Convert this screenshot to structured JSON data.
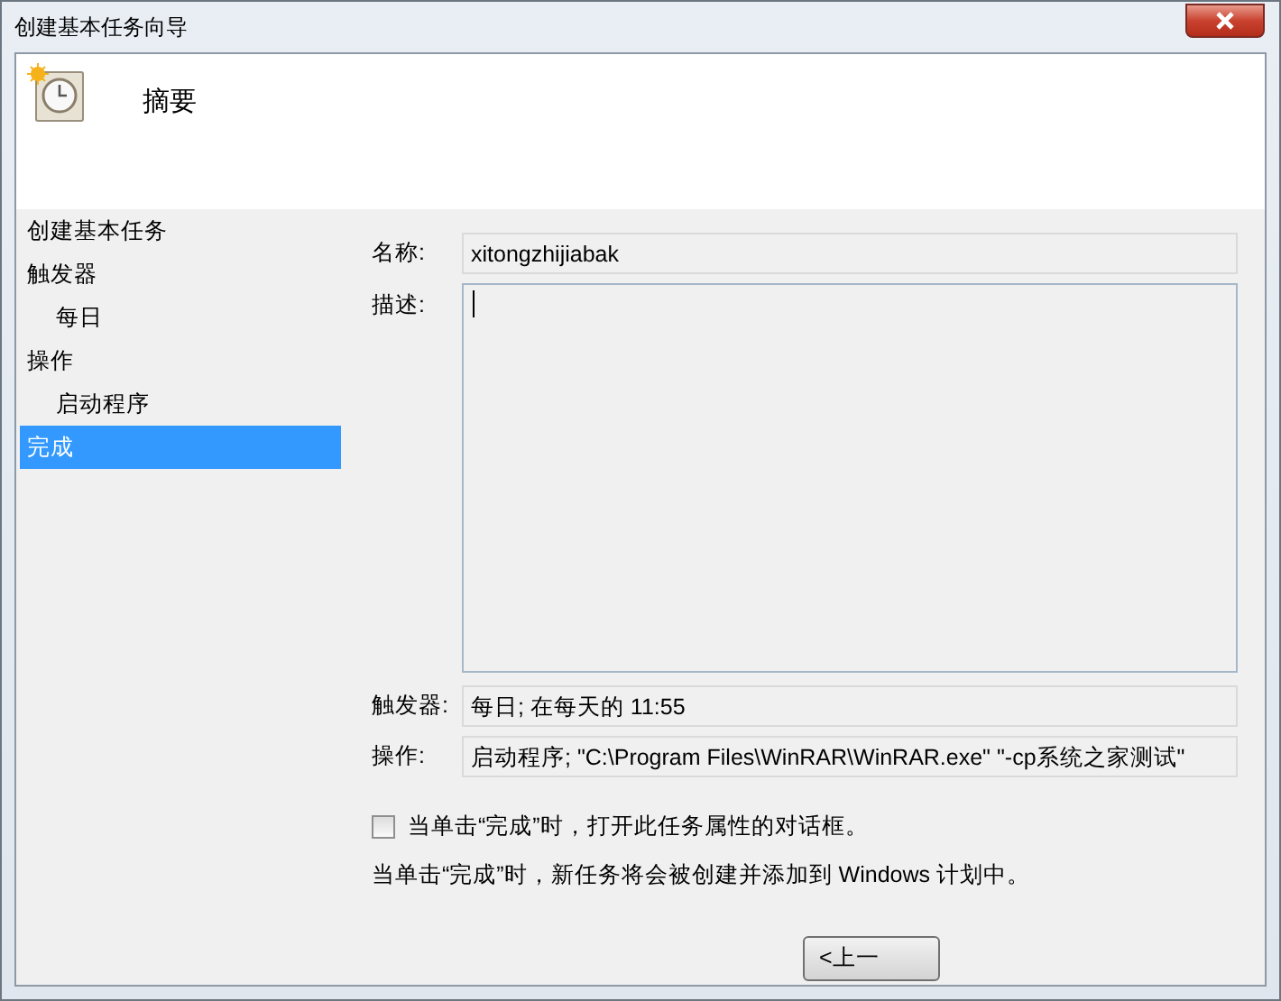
{
  "window": {
    "title": "创建基本任务向导"
  },
  "header": {
    "title": "摘要"
  },
  "steps": [
    {
      "label": "创建基本任务",
      "selected": false
    },
    {
      "label": "触发器",
      "selected": false,
      "children": [
        {
          "label": "每日",
          "selected": false
        }
      ]
    },
    {
      "label": "操作",
      "selected": false,
      "children": [
        {
          "label": "启动程序",
          "selected": false
        }
      ]
    },
    {
      "label": "完成",
      "selected": true
    }
  ],
  "form": {
    "name_label": "名称:",
    "name_value": "xitongzhijiabak",
    "description_label": "描述:",
    "trigger_label": "触发器:",
    "trigger_value": "每日; 在每天的 11:55",
    "action_label": "操作:",
    "action_value": "启动程序; \"C:\\Program Files\\WinRAR\\WinRAR.exe\" \"-cp系统之家测试\""
  },
  "open_properties": {
    "label": "当单击“完成”时，打开此任务属性的对话框。",
    "checked": false
  },
  "note": "当单击“完成”时，新任务将会被创建并添加到 Windows 计划中。",
  "buttons": [
    "<上一"
  ]
}
